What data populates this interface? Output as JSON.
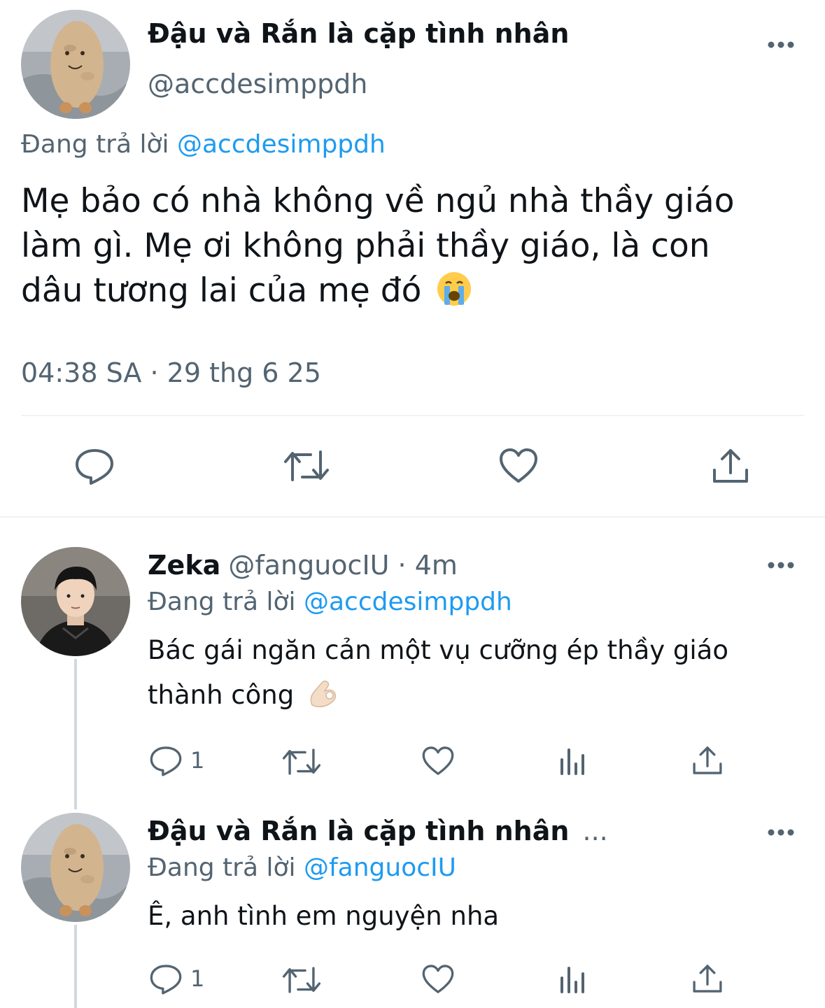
{
  "main_tweet": {
    "display_name": "Đậu và Rắn là cặp tình nhân",
    "handle": "@accdesimppdh",
    "replying_prefix": "Đang trả lời",
    "replying_to": "@accdesimppdh",
    "text_line1": "Mẹ bảo có nhà không về ngủ nhà thầy giáo",
    "text_line2": "làm gì. Mẹ ơi không phải thầy giáo, là con",
    "text_line3": "dâu tương lai của mẹ đó",
    "emoji": "loudly-crying-face",
    "timestamp": "04:38 SA · 29 thg 6 25"
  },
  "replies": [
    {
      "display_name": "Zeka",
      "handle": "@fanguocIU",
      "time": " · 4m",
      "replying_prefix": "Đang trả lời",
      "replying_to": "@accdesimppdh",
      "text_line1": "Bác gái ngăn cản một vụ cưỡng ép thầy giáo",
      "text_line2": "thành công",
      "emoji": "ok-hand",
      "reply_count": "1"
    },
    {
      "display_name": "Đậu và Rắn là cặp tình nhân",
      "truncation": "...",
      "replying_prefix": "Đang trả lời",
      "replying_to": "@fanguocIU",
      "text_line1": "Ê, anh tình em nguyện nha",
      "reply_count": "1"
    }
  ],
  "colors": {
    "accent": "#1d9bf0",
    "secondary_text": "#536471",
    "divider": "#eff3f4"
  }
}
